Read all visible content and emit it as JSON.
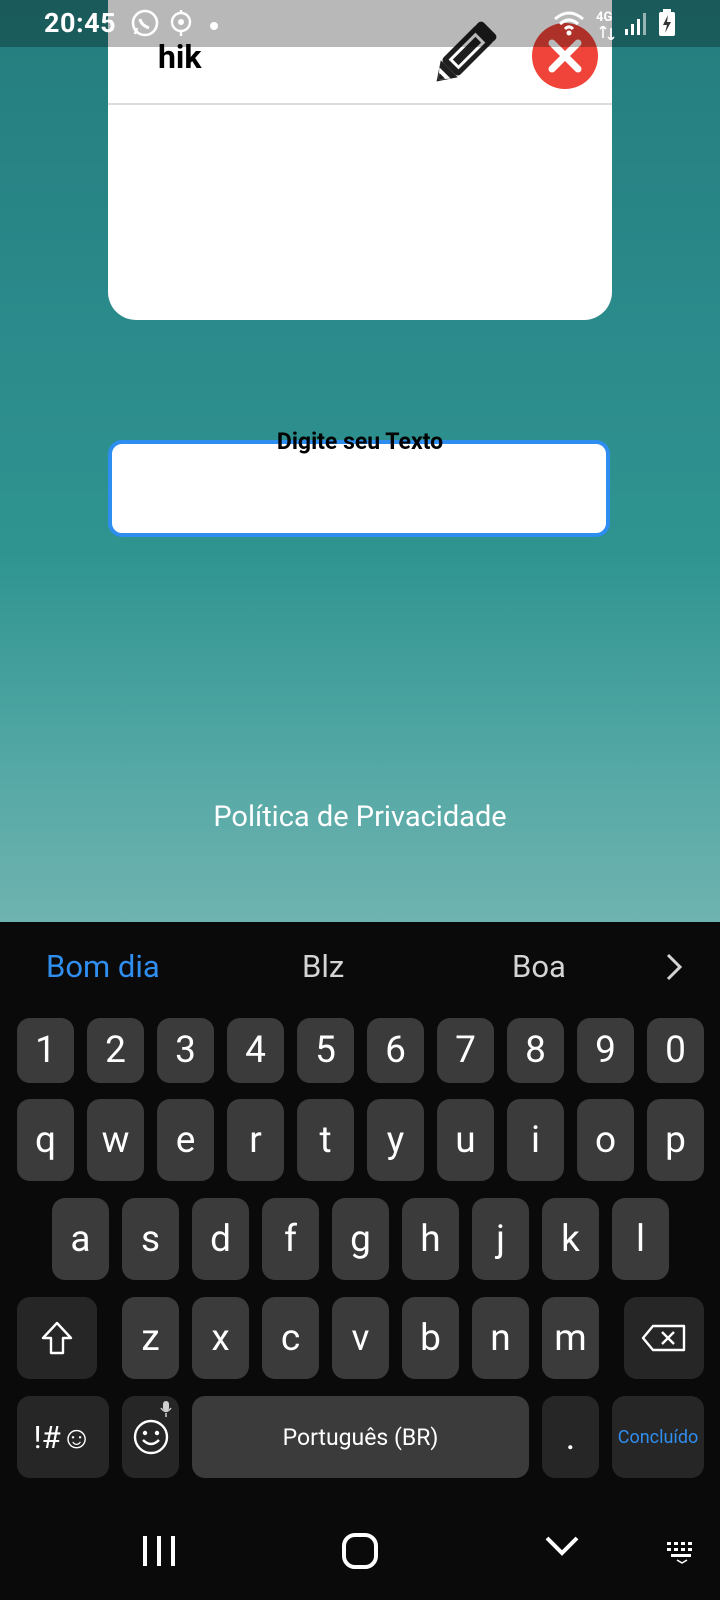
{
  "status_bar": {
    "time": "20:45",
    "network_label": "4G",
    "icons": [
      "whatsapp-icon",
      "location-icon",
      "dot-icon",
      "wifi-icon",
      "signal-icon",
      "battery-icon"
    ]
  },
  "card": {
    "title": "hik"
  },
  "input": {
    "label": "Digite seu Texto",
    "value": ""
  },
  "links": {
    "privacy": "Política de Privacidade"
  },
  "keyboard": {
    "suggestions": [
      "Bom dia",
      "Blz",
      "Boa"
    ],
    "row_numbers": [
      "1",
      "2",
      "3",
      "4",
      "5",
      "6",
      "7",
      "8",
      "9",
      "0"
    ],
    "row_top": [
      "q",
      "w",
      "e",
      "r",
      "t",
      "y",
      "u",
      "i",
      "o",
      "p"
    ],
    "row_middle": [
      "a",
      "s",
      "d",
      "f",
      "g",
      "h",
      "j",
      "k",
      "l"
    ],
    "row_bottom": [
      "z",
      "x",
      "c",
      "v",
      "b",
      "n",
      "m"
    ],
    "symbols_label": "!#☺",
    "space_label": "Português (BR)",
    "period_label": ".",
    "done_label": "Concluído"
  },
  "colors": {
    "accent": "#2f8ef0",
    "close": "#f0433a",
    "background_top": "#247d7e",
    "background_bottom": "#6fb3b0"
  }
}
